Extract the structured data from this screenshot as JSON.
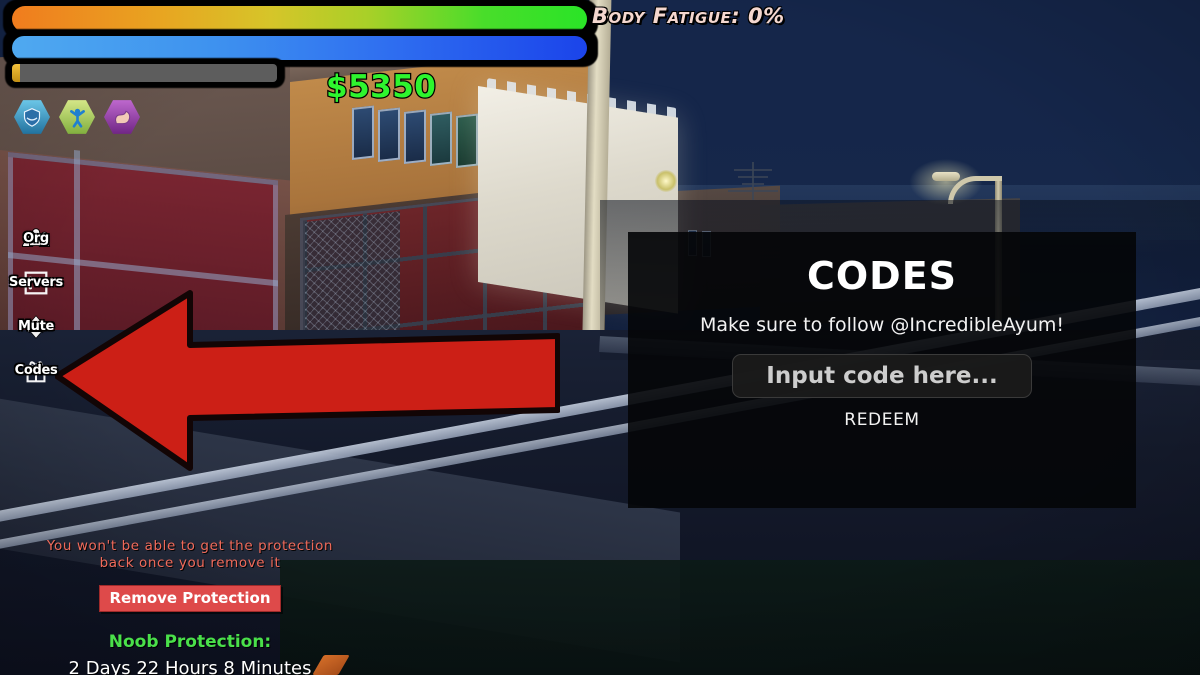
{
  "hud": {
    "money": "$5350",
    "fatigue": "Body Fatigue: 0%",
    "bars": [
      {
        "name": "health-bar",
        "value": 100
      },
      {
        "name": "stamina-bar",
        "value": 100
      },
      {
        "name": "experience-bar",
        "value": 3
      }
    ],
    "power_icons": [
      {
        "name": "shield-power-icon",
        "glyph": "◆",
        "color": "#6ec9ea"
      },
      {
        "name": "body-power-icon",
        "glyph": "⚉",
        "color": "#7fae3c"
      },
      {
        "name": "strength-power-icon",
        "glyph": "ὊA",
        "color": "#c06ad0"
      }
    ]
  },
  "sidebar": {
    "items": [
      {
        "label": "Org",
        "icon": "group-icon"
      },
      {
        "label": "Servers",
        "icon": "server-list-icon"
      },
      {
        "label": "Mute",
        "icon": "sound-icon"
      },
      {
        "label": "Codes",
        "icon": "gift-box-icon"
      }
    ]
  },
  "codes_panel": {
    "title": "CODES",
    "subtitle": "Make sure to follow @IncredibleAyum!",
    "input_placeholder": "Input code here...",
    "input_value": "",
    "redeem_label": "REDEEM"
  },
  "protection": {
    "warning_line1": "You won't be able to get the protection",
    "warning_line2": "back once you remove it",
    "remove_button": "Remove Protection",
    "status_label": "Noob Protection:",
    "time_remaining": "2 Days 22 Hours 8 Minutes"
  },
  "annotation": {
    "arrow_color": "#cc1f16",
    "arrow_direction": "left",
    "points_at": "Codes"
  },
  "colors": {
    "money_green": "#2ef52e",
    "protection_green": "#4ae04a",
    "warning_red": "#f06a5a",
    "button_red": "#de4a4a",
    "sky": "#15264a"
  }
}
